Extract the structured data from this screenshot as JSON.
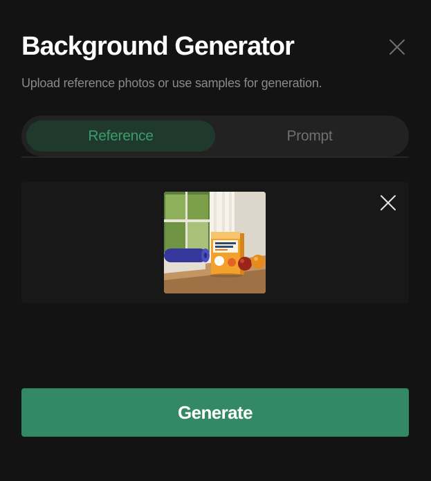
{
  "dialog": {
    "title": "Background Generator",
    "subtitle": "Upload reference photos or use samples for generation.",
    "close_icon": "close-icon"
  },
  "tabs": [
    {
      "label": "Reference",
      "active": true
    },
    {
      "label": "Prompt",
      "active": false
    }
  ],
  "upload": {
    "thumbnail_icon": "uploaded-reference-image",
    "remove_icon": "close-icon"
  },
  "actions": {
    "generate_label": "Generate"
  },
  "colors": {
    "background": "#131313",
    "accent": "#338963",
    "active_tab_bg": "#1f3a2d",
    "active_tab_text": "#3d9a6c",
    "inactive_tab_text": "#6f6f6f",
    "muted_text": "#8a8a8a"
  }
}
